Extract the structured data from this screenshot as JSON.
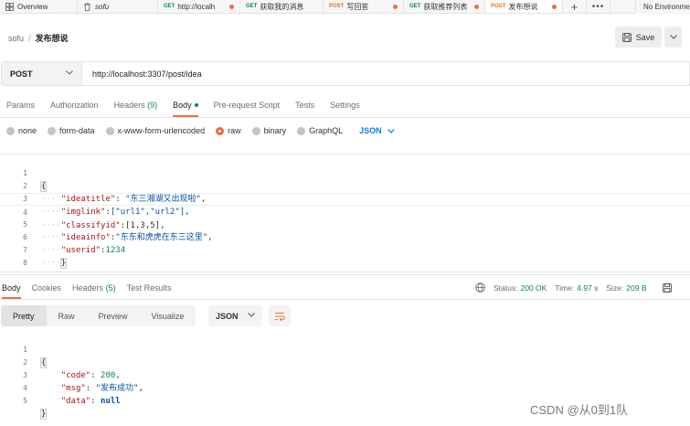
{
  "tabs": [
    {
      "method": "",
      "label": "Overview",
      "icon": "overview-icon"
    },
    {
      "method": "",
      "label": "sofu",
      "icon": "trash-icon"
    },
    {
      "method": "GET",
      "label": "http://localh",
      "dirty": true
    },
    {
      "method": "GET",
      "label": "获取我的消息",
      "dirty": false
    },
    {
      "method": "POST",
      "label": "写回答",
      "dirty": true
    },
    {
      "method": "GET",
      "label": "获取推荐列表",
      "dirty": true
    },
    {
      "method": "POST",
      "label": "发布想说",
      "dirty": true
    }
  ],
  "environment": "No Environment",
  "breadcrumb": {
    "workspace": "sofu",
    "separator": "/",
    "name": "发布想说"
  },
  "save_label": "Save",
  "request": {
    "method": "POST",
    "url": "http://localhost:3307/post/idea"
  },
  "request_tabs": [
    {
      "label": "Params"
    },
    {
      "label": "Authorization"
    },
    {
      "label": "Headers",
      "count": "(9)"
    },
    {
      "label": "Body",
      "active": true
    },
    {
      "label": "Pre-request Script"
    },
    {
      "label": "Tests"
    },
    {
      "label": "Settings"
    }
  ],
  "body_types": [
    "none",
    "form-data",
    "x-www-form-urlencoded",
    "raw",
    "binary",
    "GraphQL"
  ],
  "body_type_selected": "raw",
  "body_format": "JSON",
  "request_body": {
    "line_numbers": [
      "1",
      "2",
      "3",
      "4",
      "5",
      "6",
      "7",
      "8"
    ],
    "open_brace": "{",
    "close_brace": "}",
    "l2": {
      "key": "\"ideatitle\"",
      "value": "\"东三湘湖又出现啦\"",
      "tail": ","
    },
    "l3": {
      "key": "\"imglink\"",
      "value": "[\"url1\",\"url2\"]",
      "tail": ","
    },
    "l4": {
      "key": "\"classifyid\"",
      "value": "[1,3,5]",
      "tail": ","
    },
    "l5": {
      "key": "\"ideainfo\"",
      "value": "\"东东和虎虎在东三这里\"",
      "tail": ","
    },
    "l6": {
      "key": "\"userid\"",
      "value": "1234",
      "tail": ""
    }
  },
  "response_tabs": [
    {
      "label": "Body",
      "active": true
    },
    {
      "label": "Cookies"
    },
    {
      "label": "Headers",
      "count": "(5)"
    },
    {
      "label": "Test Results"
    }
  ],
  "status": {
    "label": "Status:",
    "value": "200 OK"
  },
  "time": {
    "label": "Time:",
    "value": "4.97 s"
  },
  "size": {
    "label": "Size:",
    "value": "209 B"
  },
  "response_formats": [
    "Pretty",
    "Raw",
    "Preview",
    "Visualize"
  ],
  "response_format_selected": "Pretty",
  "response_lang": "JSON",
  "response_body": {
    "line_numbers": [
      "1",
      "2",
      "3",
      "4",
      "5"
    ],
    "open_brace": "{",
    "close_brace": "}",
    "l2": {
      "key": "\"code\"",
      "value": "200",
      "tail": ","
    },
    "l3": {
      "key": "\"msg\"",
      "value": "\"发布成功\"",
      "tail": ","
    },
    "l4": {
      "key": "\"data\"",
      "value": "null",
      "tail": ""
    }
  },
  "watermark": "CSDN @从0到1队",
  "colors": {
    "accent": "#f26b3a",
    "get": "#0c8a46",
    "post": "#e0741b",
    "link": "#097bed"
  }
}
